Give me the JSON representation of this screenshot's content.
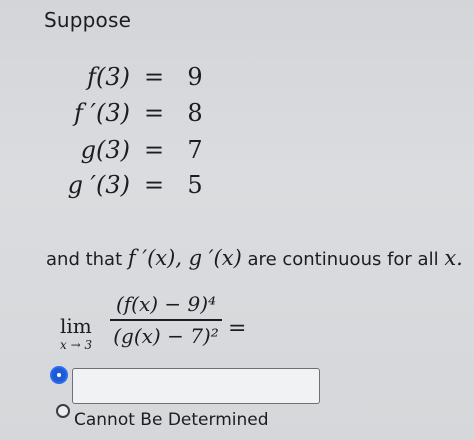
{
  "question": {
    "intro": "Suppose",
    "equations": [
      {
        "lhs": "f(3)",
        "rel": "=",
        "rhs": "9"
      },
      {
        "lhs": "f ′(3)",
        "rel": "=",
        "rhs": "8"
      },
      {
        "lhs": "g(3)",
        "rel": "=",
        "rhs": "7"
      },
      {
        "lhs": "g ′(3)",
        "rel": "=",
        "rhs": "5"
      }
    ],
    "condition": {
      "prefix": "and that",
      "functions": "f ′(x), g ′(x)",
      "middle": "are continuous for all",
      "variable": "x."
    },
    "limit": {
      "word": "lim",
      "subscript": "x → 3",
      "numerator": "(f(x) − 9)⁴",
      "denominator": "(g(x) − 7)²",
      "equals": "="
    }
  },
  "answer": {
    "input_value": "",
    "option_cannot_determine": "Cannot Be Determined"
  },
  "colors": {
    "background": "#d7d9dc",
    "radio_accent": "#1f5bd6",
    "text": "#1b1d20"
  }
}
